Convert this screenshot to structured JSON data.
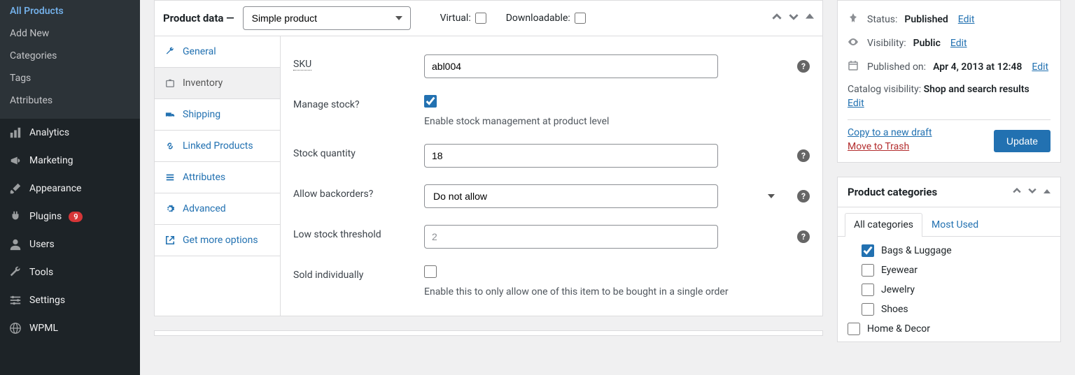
{
  "sidebar": {
    "sub_items": [
      "All Products",
      "Add New",
      "Categories",
      "Tags",
      "Attributes"
    ],
    "menu_items": [
      {
        "label": "Analytics",
        "icon": "chart"
      },
      {
        "label": "Marketing",
        "icon": "megaphone"
      },
      {
        "label": "Appearance",
        "icon": "brush"
      },
      {
        "label": "Plugins",
        "icon": "plug",
        "badge": "9"
      },
      {
        "label": "Users",
        "icon": "user"
      },
      {
        "label": "Tools",
        "icon": "wrench"
      },
      {
        "label": "Settings",
        "icon": "sliders"
      },
      {
        "label": "WPML",
        "icon": "globe"
      }
    ]
  },
  "product_data": {
    "title": "Product data —",
    "type_selected": "Simple product",
    "virtual_label": "Virtual:",
    "downloadable_label": "Downloadable:",
    "tabs": [
      "General",
      "Inventory",
      "Shipping",
      "Linked Products",
      "Attributes",
      "Advanced",
      "Get more options"
    ],
    "active_tab": "Inventory",
    "form": {
      "sku_label": "SKU",
      "sku_value": "abl004",
      "manage_stock_label": "Manage stock?",
      "manage_stock_help": "Enable stock management at product level",
      "manage_stock_checked": true,
      "stock_qty_label": "Stock quantity",
      "stock_qty_value": "18",
      "backorders_label": "Allow backorders?",
      "backorders_value": "Do not allow",
      "low_stock_label": "Low stock threshold",
      "low_stock_placeholder": "2",
      "sold_ind_label": "Sold individually",
      "sold_ind_help": "Enable this to only allow one of this item to be bought in a single order"
    }
  },
  "publish": {
    "status_label": "Status:",
    "status_value": "Published",
    "visibility_label": "Visibility:",
    "visibility_value": "Public",
    "published_label": "Published on:",
    "published_value": "Apr 4, 2013 at 12:48",
    "edit": "Edit",
    "catalog_label": "Catalog visibility:",
    "catalog_value": "Shop and search results",
    "copy_draft": "Copy to a new draft",
    "move_trash": "Move to Trash",
    "update": "Update"
  },
  "categories": {
    "title": "Product categories",
    "tab_all": "All categories",
    "tab_most": "Most Used",
    "items": [
      {
        "label": "Bags & Luggage",
        "checked": true,
        "indent": 1
      },
      {
        "label": "Eyewear",
        "checked": false,
        "indent": 1
      },
      {
        "label": "Jewelry",
        "checked": false,
        "indent": 1
      },
      {
        "label": "Shoes",
        "checked": false,
        "indent": 1
      },
      {
        "label": "Home & Decor",
        "checked": false,
        "indent": 0
      }
    ]
  }
}
